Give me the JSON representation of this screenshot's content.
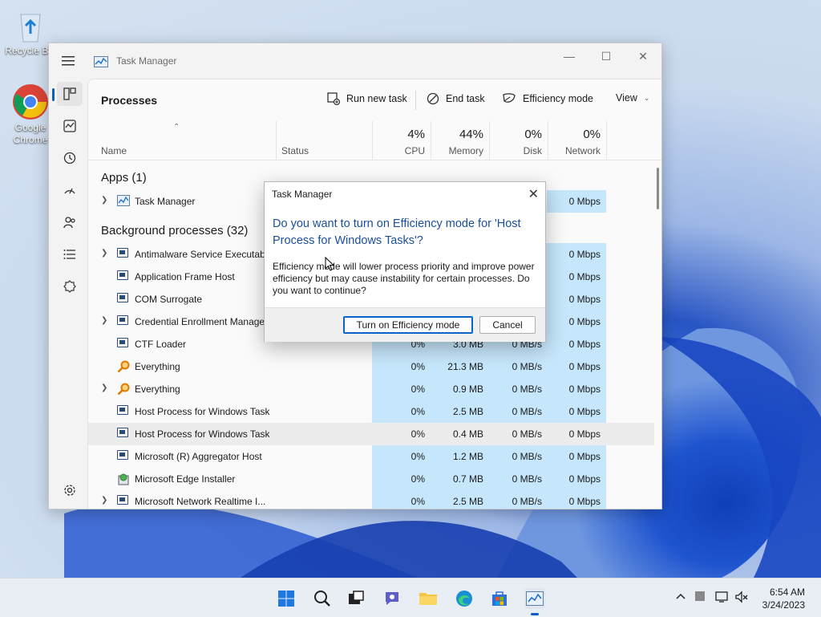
{
  "desktop": {
    "icons": [
      {
        "label": "Recycle Bin",
        "icon": "recycle-bin-icon"
      },
      {
        "label": "Google Chrome",
        "icon": "chrome-icon"
      }
    ]
  },
  "window": {
    "title": "Task Manager",
    "nav": [
      "processes-icon",
      "performance-icon",
      "app-history-icon",
      "startup-icon",
      "users-icon",
      "details-icon",
      "services-icon",
      "settings-icon"
    ]
  },
  "toolbar": {
    "page_title": "Processes",
    "run_new_task": "Run new task",
    "end_task": "End task",
    "efficiency_mode": "Efficiency mode",
    "view": "View"
  },
  "columns": {
    "name": "Name",
    "status": "Status",
    "cpu": {
      "pct": "4%",
      "label": "CPU"
    },
    "memory": {
      "pct": "44%",
      "label": "Memory"
    },
    "disk": {
      "pct": "0%",
      "label": "Disk"
    },
    "network": {
      "pct": "0%",
      "label": "Network"
    }
  },
  "groups": {
    "apps": "Apps (1)",
    "background": "Background processes (32)"
  },
  "rows": [
    {
      "name": "Task Manager",
      "cpu": "",
      "mem": "",
      "disk": "",
      "net": "0 Mbps",
      "expand": true,
      "icon": "taskmgr"
    },
    {
      "name": "Antimalware Service Executable",
      "cpu": "",
      "mem": "",
      "disk": "",
      "net": "0 Mbps",
      "expand": true,
      "icon": "proc"
    },
    {
      "name": "Application Frame Host",
      "cpu": "",
      "mem": "",
      "disk": "",
      "net": "0 Mbps",
      "expand": false,
      "icon": "proc"
    },
    {
      "name": "COM Surrogate",
      "cpu": "",
      "mem": "",
      "disk": "",
      "net": "0 Mbps",
      "expand": false,
      "icon": "proc"
    },
    {
      "name": "Credential Enrollment Manager",
      "cpu": "",
      "mem": "",
      "disk": "",
      "net": "0 Mbps",
      "expand": true,
      "icon": "proc"
    },
    {
      "name": "CTF Loader",
      "cpu": "0%",
      "mem": "3.0 MB",
      "disk": "0 MB/s",
      "net": "0 Mbps",
      "expand": false,
      "icon": "proc"
    },
    {
      "name": "Everything",
      "cpu": "0%",
      "mem": "21.3 MB",
      "disk": "0 MB/s",
      "net": "0 Mbps",
      "expand": false,
      "icon": "search"
    },
    {
      "name": "Everything",
      "cpu": "0%",
      "mem": "0.9 MB",
      "disk": "0 MB/s",
      "net": "0 Mbps",
      "expand": true,
      "icon": "search"
    },
    {
      "name": "Host Process for Windows Tasks",
      "cpu": "0%",
      "mem": "2.5 MB",
      "disk": "0 MB/s",
      "net": "0 Mbps",
      "expand": false,
      "icon": "proc"
    },
    {
      "name": "Host Process for Windows Tasks",
      "cpu": "0%",
      "mem": "0.4 MB",
      "disk": "0 MB/s",
      "net": "0 Mbps",
      "expand": false,
      "icon": "proc"
    },
    {
      "name": "Microsoft (R) Aggregator Host",
      "cpu": "0%",
      "mem": "1.2 MB",
      "disk": "0 MB/s",
      "net": "0 Mbps",
      "expand": false,
      "icon": "proc"
    },
    {
      "name": "Microsoft Edge Installer",
      "cpu": "0%",
      "mem": "0.7 MB",
      "disk": "0 MB/s",
      "net": "0 Mbps",
      "expand": false,
      "icon": "installer"
    },
    {
      "name": "Microsoft Network Realtime I...",
      "cpu": "0%",
      "mem": "2.5 MB",
      "disk": "0 MB/s",
      "net": "0 Mbps",
      "expand": true,
      "icon": "proc"
    }
  ],
  "dialog": {
    "title": "Task Manager",
    "heading": "Do you want to turn on Efficiency mode for 'Host Process for Windows Tasks'?",
    "body": "Efficiency mode will lower process priority and improve power efficiency but may cause instability for certain processes. Do you want to continue?",
    "confirm": "Turn on Efficiency mode",
    "cancel": "Cancel"
  },
  "taskbar": {
    "time": "6:54 AM",
    "date": "3/24/2023"
  },
  "colors": {
    "accent": "#0a5ec4",
    "usage_cell": "#c6e6fb",
    "dialog_heading": "#1a4f9c"
  }
}
